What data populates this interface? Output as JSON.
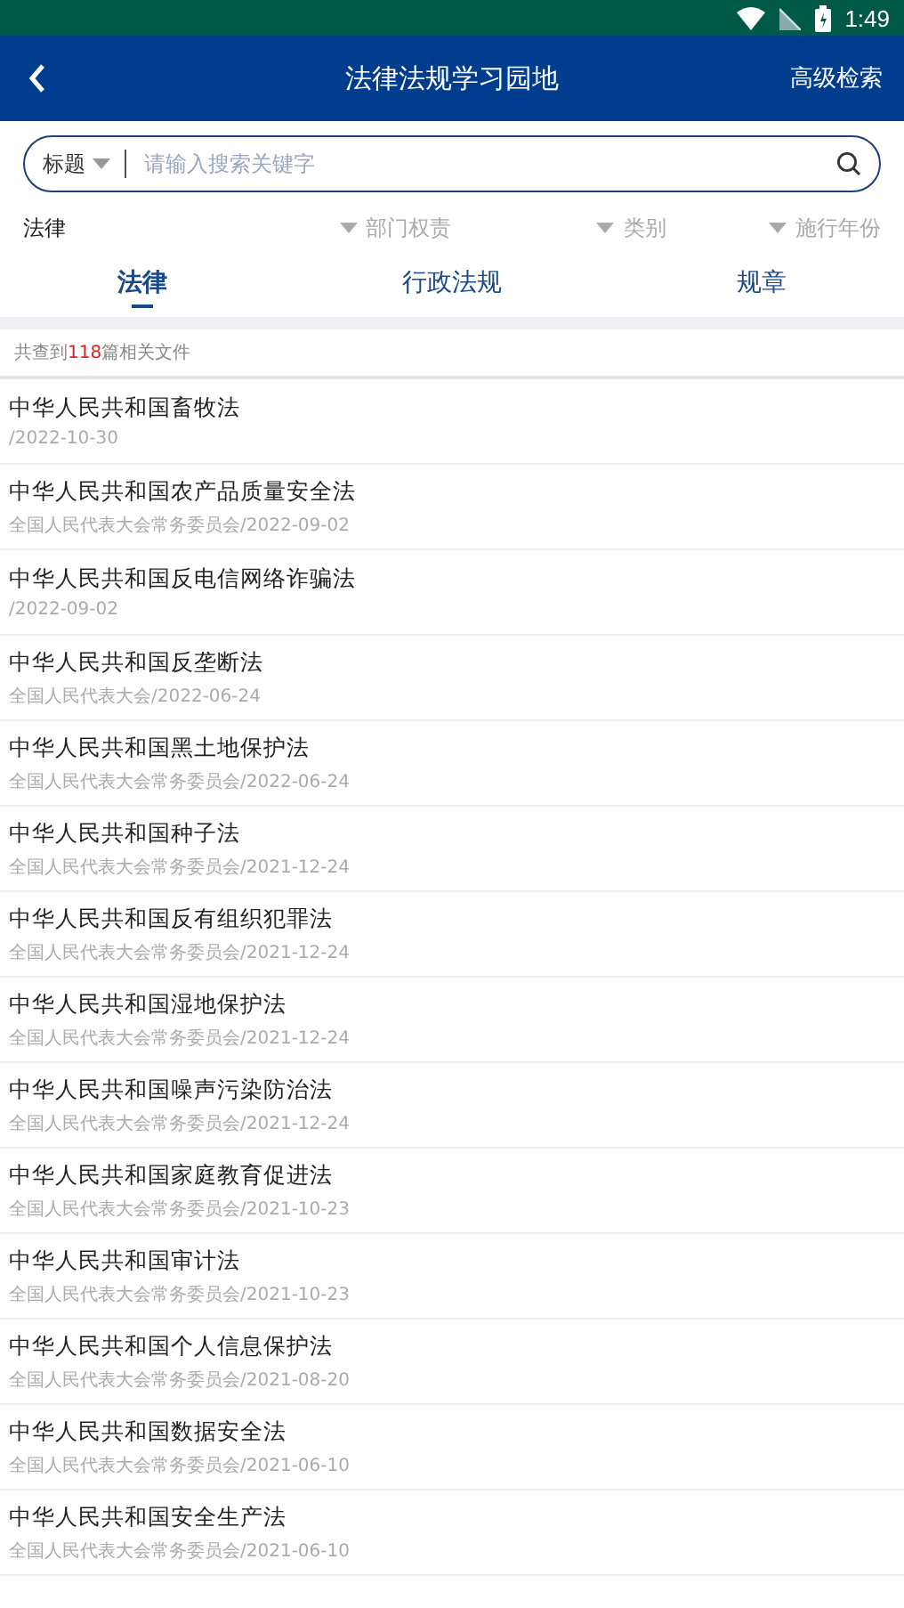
{
  "status_bar": {
    "time": "1:49"
  },
  "header": {
    "title": "法律法规学习园地",
    "action": "高级检索"
  },
  "search": {
    "scope": "标题",
    "placeholder": "请输入搜索关键字"
  },
  "filters": [
    {
      "label": "法律",
      "selected": true
    },
    {
      "label": "部门权责",
      "selected": false
    },
    {
      "label": "类别",
      "selected": false
    },
    {
      "label": "施行年份",
      "selected": false
    }
  ],
  "tabs": [
    {
      "label": "法律",
      "selected": true
    },
    {
      "label": "行政法规",
      "selected": false
    },
    {
      "label": "规章",
      "selected": false
    }
  ],
  "result_count": {
    "prefix": "共查到",
    "count": "118",
    "suffix": "篇相关文件"
  },
  "items": [
    {
      "title": "中华人民共和国畜牧法",
      "meta": "/2022-10-30"
    },
    {
      "title": "中华人民共和国农产品质量安全法",
      "meta": "全国人民代表大会常务委员会/2022-09-02"
    },
    {
      "title": "中华人民共和国反电信网络诈骗法",
      "meta": "/2022-09-02"
    },
    {
      "title": "中华人民共和国反垄断法",
      "meta": "全国人民代表大会/2022-06-24"
    },
    {
      "title": "中华人民共和国黑土地保护法",
      "meta": "全国人民代表大会常务委员会/2022-06-24"
    },
    {
      "title": "中华人民共和国种子法",
      "meta": "全国人民代表大会常务委员会/2021-12-24"
    },
    {
      "title": "中华人民共和国反有组织犯罪法",
      "meta": "全国人民代表大会常务委员会/2021-12-24"
    },
    {
      "title": "中华人民共和国湿地保护法",
      "meta": "全国人民代表大会常务委员会/2021-12-24"
    },
    {
      "title": "中华人民共和国噪声污染防治法",
      "meta": "全国人民代表大会常务委员会/2021-12-24"
    },
    {
      "title": "中华人民共和国家庭教育促进法",
      "meta": "全国人民代表大会常务委员会/2021-10-23"
    },
    {
      "title": "中华人民共和国审计法",
      "meta": "全国人民代表大会常务委员会/2021-10-23"
    },
    {
      "title": "中华人民共和国个人信息保护法",
      "meta": "全国人民代表大会常务委员会/2021-08-20"
    },
    {
      "title": "中华人民共和国数据安全法",
      "meta": "全国人民代表大会常务委员会/2021-06-10"
    },
    {
      "title": "中华人民共和国安全生产法",
      "meta": "全国人民代表大会常务委员会/2021-06-10"
    }
  ]
}
